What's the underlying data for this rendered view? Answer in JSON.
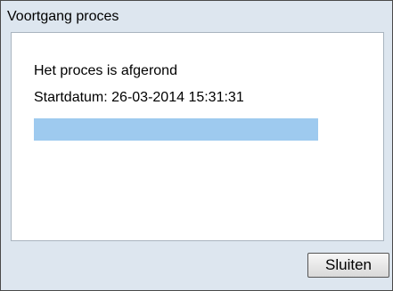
{
  "dialog": {
    "title": "Voortgang proces",
    "status_text": "Het proces is afgerond",
    "start_text": "Startdatum: 26-03-2014 15:31:31",
    "progress": 1.0,
    "progress_color": "#9ecaef",
    "close_label": "Sluiten"
  }
}
